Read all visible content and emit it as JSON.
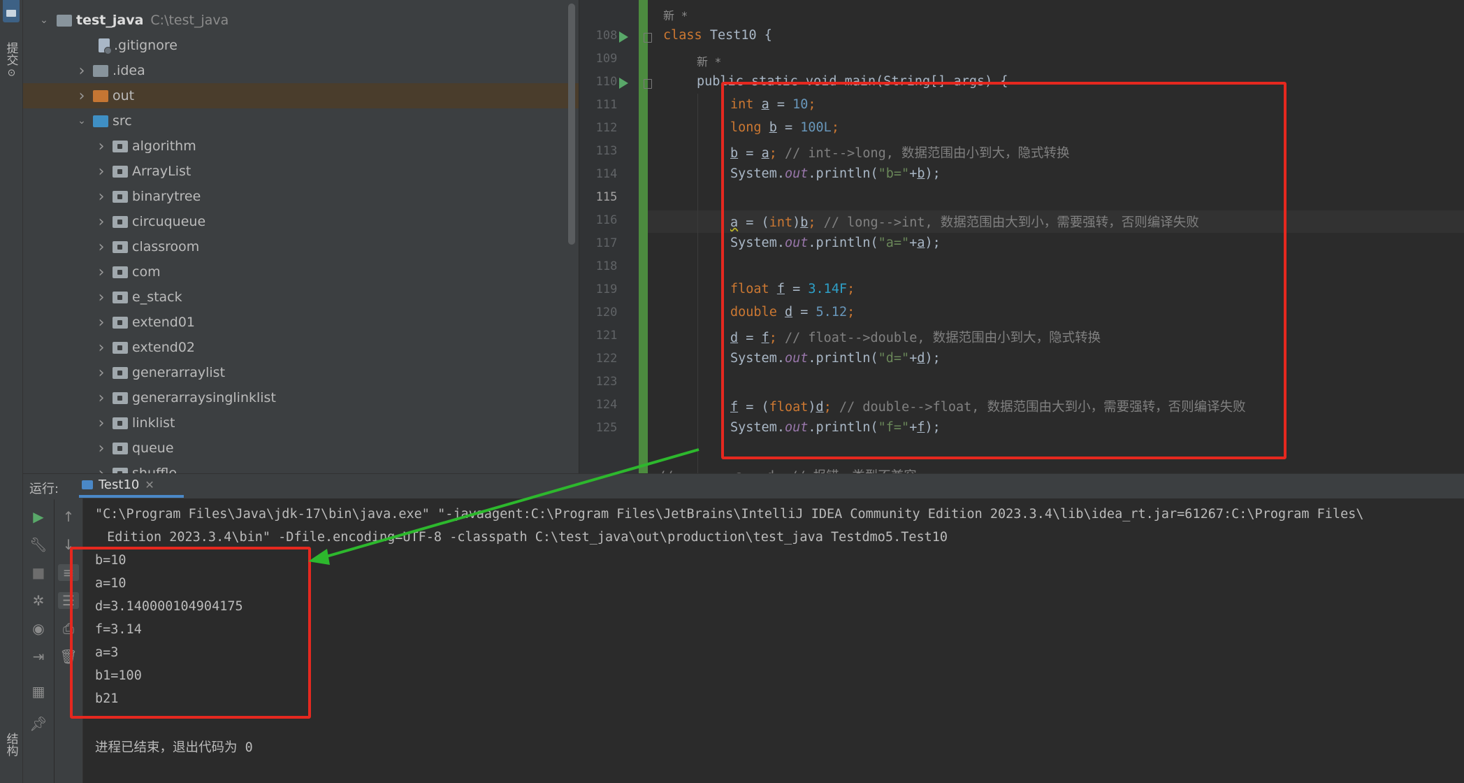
{
  "left_strip": {
    "commit_tab": "提交",
    "structure_tab": "结构"
  },
  "project": {
    "root": {
      "name": "test_java",
      "path": "C:\\test_java"
    },
    "items": [
      {
        "label": ".gitignore",
        "type": "file"
      },
      {
        "label": ".idea",
        "type": "folder"
      },
      {
        "label": "out",
        "type": "folder-excluded"
      },
      {
        "label": "src",
        "type": "source-root"
      },
      {
        "label": "algorithm",
        "type": "package"
      },
      {
        "label": "ArrayList",
        "type": "package"
      },
      {
        "label": "binarytree",
        "type": "package"
      },
      {
        "label": "circuqueue",
        "type": "package"
      },
      {
        "label": "classroom",
        "type": "package"
      },
      {
        "label": "com",
        "type": "package"
      },
      {
        "label": "e_stack",
        "type": "package"
      },
      {
        "label": "extend01",
        "type": "package"
      },
      {
        "label": "extend02",
        "type": "package"
      },
      {
        "label": "generarraylist",
        "type": "package"
      },
      {
        "label": "generarraysinglinklist",
        "type": "package"
      },
      {
        "label": "linklist",
        "type": "package"
      },
      {
        "label": "queue",
        "type": "package"
      },
      {
        "label": "shuffle",
        "type": "package"
      }
    ]
  },
  "editor": {
    "hint_new": "新 *",
    "current_line": "115",
    "line_numbers": [
      "108",
      "109",
      "110",
      "111",
      "112",
      "113",
      "114",
      "115",
      "116",
      "117",
      "118",
      "119",
      "120",
      "121",
      "122",
      "123",
      "124",
      "125"
    ],
    "class_decl": {
      "kw": "class",
      "name": "Test10 {"
    },
    "main_decl": "public static void main(String[] args) {",
    "code": {
      "l110": {
        "type": "int",
        "var": "a",
        "op": " = ",
        "val": "10",
        "end": ";"
      },
      "l111": {
        "type": "long",
        "var": "b",
        "op": " = ",
        "val": "100L",
        "end": ";"
      },
      "l112": {
        "lhs": "b",
        "op": " = ",
        "rhs": "a",
        "end": ";",
        "comment": " // int-->long, 数据范围由小到大，隐式转换"
      },
      "l113": {
        "pre": "System.",
        "fld": "out",
        "mid": ".println(",
        "str": "\"b=\"",
        "plus": "+",
        "var": "b",
        "end": ");"
      },
      "l115": {
        "lhs": "a",
        "op": " = (",
        "cast": "int",
        "close": ")",
        "rhs": "b",
        "end": ";",
        "comment": " // long-->int, 数据范围由大到小，需要强转，否则编译失败"
      },
      "l116": {
        "pre": "System.",
        "fld": "out",
        "mid": ".println(",
        "str": "\"a=\"",
        "plus": "+",
        "var": "a",
        "end": ");"
      },
      "l118": {
        "type": "float",
        "var": "f",
        "op": " = ",
        "val": "3.14F",
        "end": ";"
      },
      "l119": {
        "type": "double",
        "var": "d",
        "op": " = ",
        "val": "5.12",
        "end": ";"
      },
      "l120": {
        "lhs": "d",
        "op": " = ",
        "rhs": "f",
        "end": ";",
        "comment": " // float-->double, 数据范围由小到大，隐式转换"
      },
      "l121": {
        "pre": "System.",
        "fld": "out",
        "mid": ".println(",
        "str": "\"d=\"",
        "plus": "+",
        "var": "d",
        "end": ");"
      },
      "l123": {
        "lhs": "f",
        "op": " = (",
        "cast": "float",
        "close": ")",
        "rhs": "d",
        "end": ";",
        "comment": " // double-->float, 数据范围由大到小，需要强转，否则编译失败"
      },
      "l124": {
        "pre": "System.",
        "fld": "out",
        "mid": ".println(",
        "str": "\"f=\"",
        "plus": "+",
        "var": "f",
        "end": ");"
      },
      "l126_partial": "//        a = d; // 报错，类型不兼容"
    }
  },
  "run": {
    "label": "运行:",
    "tab": "Test10",
    "command_line1": "\"C:\\Program Files\\Java\\jdk-17\\bin\\java.exe\" \"-javaagent:C:\\Program Files\\JetBrains\\IntelliJ IDEA Community Edition 2023.3.4\\lib\\idea_rt.jar=61267:C:\\Program Files\\",
    "command_line2": " Edition 2023.3.4\\bin\" -Dfile.encoding=UTF-8 -classpath C:\\test_java\\out\\production\\test_java Testdmo5.Test10",
    "output": [
      "b=10",
      "a=10",
      "d=3.140000104904175",
      "f=3.14",
      "a=3",
      "b1=100",
      "b21"
    ],
    "exit_message": "进程已结束，退出代码为 0"
  },
  "colors": {
    "annotation_red": "#e5281f",
    "annotation_arrow": "#2db82d",
    "vcs_green": "#4c8b3f",
    "run_green": "#59a869"
  }
}
